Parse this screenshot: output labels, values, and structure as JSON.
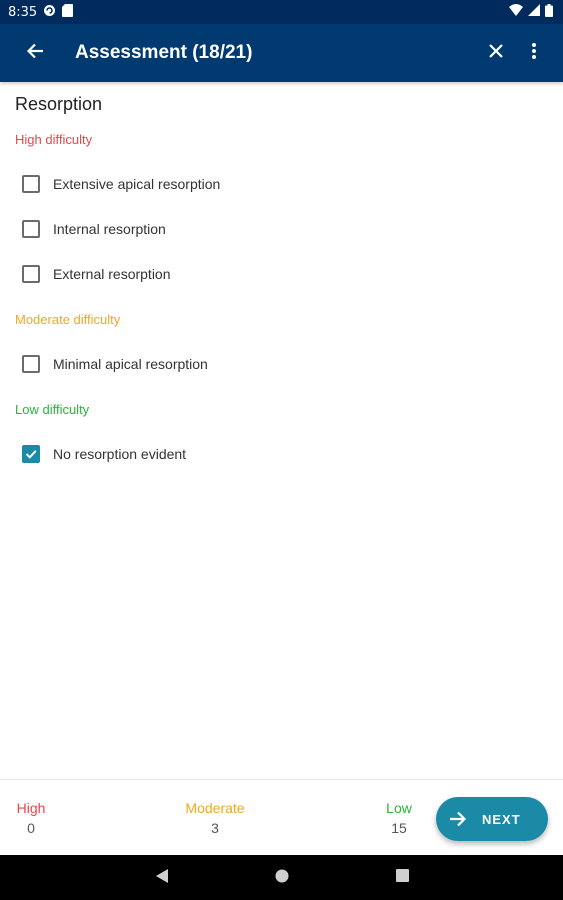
{
  "status_bar": {
    "time": "8:35"
  },
  "app_bar": {
    "title": "Assessment (18/21)",
    "back_icon": "arrow-back-icon",
    "close_icon": "close-icon",
    "menu_icon": "more-vert-icon"
  },
  "section": {
    "title": "Resorption"
  },
  "groups": [
    {
      "label": "High difficulty",
      "color": "#e5484d",
      "options": [
        {
          "label": "Extensive apical resorption",
          "checked": false
        },
        {
          "label": "Internal resorption",
          "checked": false
        },
        {
          "label": "External resorption",
          "checked": false
        }
      ]
    },
    {
      "label": "Moderate difficulty",
      "color": "#f0a81c",
      "options": [
        {
          "label": "Minimal apical resorption",
          "checked": false
        }
      ]
    },
    {
      "label": "Low difficulty",
      "color": "#27b53a",
      "options": [
        {
          "label": "No resorption evident",
          "checked": true
        }
      ]
    }
  ],
  "summary": {
    "high": {
      "label": "High",
      "value": "0",
      "color": "#e5484d"
    },
    "moderate": {
      "label": "Moderate",
      "value": "3",
      "color": "#f0a81c"
    },
    "low": {
      "label": "Low",
      "value": "15",
      "color": "#27b53a"
    }
  },
  "next_button": {
    "label": "NEXT",
    "icon": "arrow-forward-icon"
  },
  "colors": {
    "app_bar": "#003a70",
    "status_bar": "#002b5c",
    "accent": "#1b8aa6"
  }
}
